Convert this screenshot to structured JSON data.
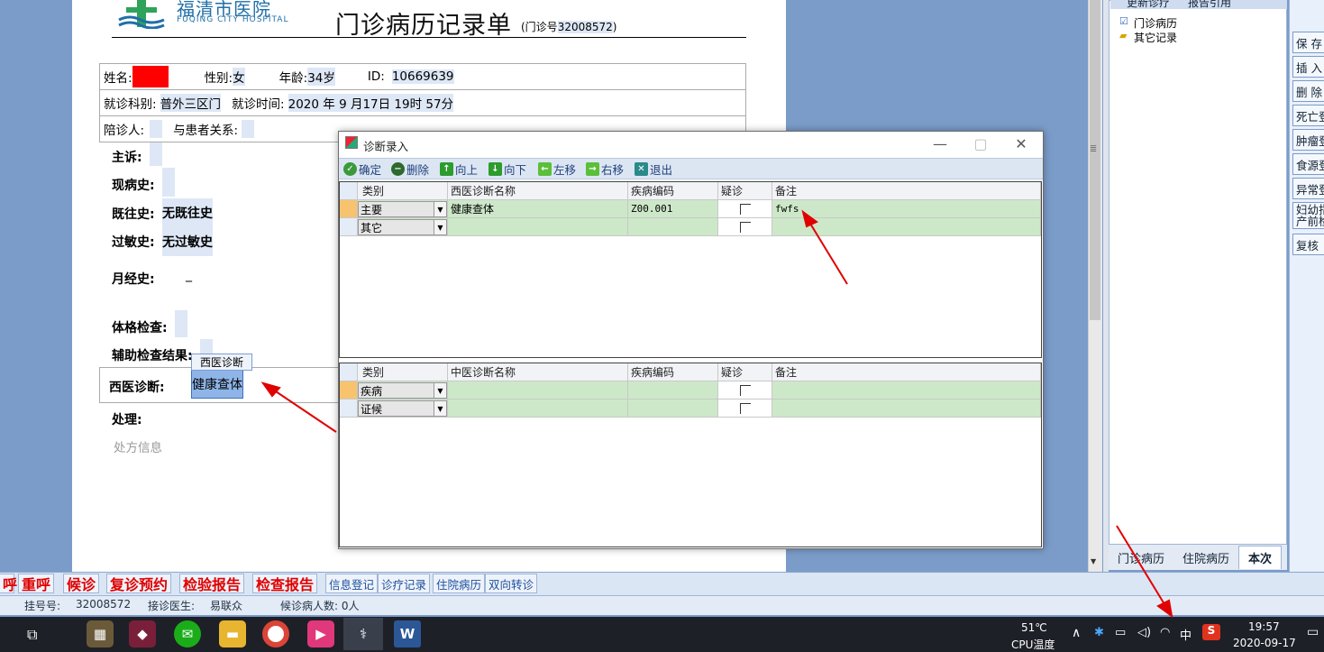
{
  "hospital": {
    "name_cn": "福清市医院",
    "name_en": "FUQING CITY HOSPITAL"
  },
  "record": {
    "title": "门诊病历记录单",
    "no_prefix": "(门诊号",
    "no": "32008572",
    "no_suffix": ")"
  },
  "patient": {
    "name_label": "姓名:",
    "gender_label": "性别:",
    "gender": "女",
    "age_label": "年龄:",
    "age": "34岁",
    "id_label": "ID:",
    "id": "10669639",
    "dept_label": "就诊科别:",
    "dept": "普外三区门",
    "time_label": "就诊时间:",
    "time": "2020 年 9 月17日 19时 57分",
    "companion_label": "陪诊人:",
    "relation_label": "与患者关系:"
  },
  "history": {
    "chief_label": "主诉:",
    "present_label": "现病史:",
    "past_label": "既往史:",
    "past": "无既往史",
    "allergy_label": "过敏史:",
    "allergy": "无过敏史",
    "menses_label": "月经史:",
    "menses": "_",
    "exam_label": "体格检查:",
    "aux_label": "辅助检查结果:",
    "dx_label": "西医诊断:",
    "dx_value": "健康查体",
    "dx_tip": "西医诊断",
    "treat_label": "处理:",
    "rx_placeholder": "处方信息"
  },
  "right_panel": {
    "top_tabs": [
      "更新诊疗",
      "报告引用"
    ],
    "tree": [
      "门诊病历",
      "其它记录"
    ],
    "bottom_tabs": [
      "门诊病历",
      "住院病历",
      "本次"
    ],
    "buttons": [
      "保 存",
      "插 入",
      "删 除",
      "死亡登",
      "肿瘤登",
      "食源登",
      "异常登",
      "妇幼指",
      "产前检",
      "复核"
    ]
  },
  "toolbar": {
    "red": [
      "呼",
      "重呼",
      "候诊",
      "复诊预约",
      "检验报告",
      "检查报告"
    ],
    "blue": [
      "信息登记",
      "诊疗记录",
      "住院病历",
      "双向转诊"
    ]
  },
  "status": {
    "reg_label": "挂号号:",
    "reg_no": "32008572",
    "doctor_label": "接诊医生:",
    "doctor": "易联众",
    "waiting": "候诊病人数: 0人"
  },
  "taskbar": {
    "temp": "51℃",
    "temp_label": "CPU温度",
    "ime": "中",
    "time": "19:57",
    "date": "2020-09-17"
  },
  "dialog": {
    "title": "诊断录入",
    "toolbar": [
      "确定",
      "删除",
      "向上",
      "向下",
      "左移",
      "右移",
      "退出"
    ],
    "west": {
      "headers": [
        "类别",
        "西医诊断名称",
        "疾病编码",
        "疑诊",
        "备注"
      ],
      "rows": [
        {
          "type": "主要",
          "name": "健康查体",
          "code": "Z00.001",
          "note": "fwfs"
        },
        {
          "type": "其它",
          "name": "",
          "code": "",
          "note": ""
        }
      ]
    },
    "tcm": {
      "headers": [
        "类别",
        "中医诊断名称",
        "疾病编码",
        "疑诊",
        "备注"
      ],
      "rows": [
        {
          "type": "疾病",
          "name": "",
          "code": "",
          "note": ""
        },
        {
          "type": "证候",
          "name": "",
          "code": "",
          "note": ""
        }
      ]
    }
  },
  "colors": {
    "accent": "#1f6fa8",
    "annotation": "#e00000",
    "grid_row": "#cde8c9",
    "selection": "#f7c36f"
  }
}
